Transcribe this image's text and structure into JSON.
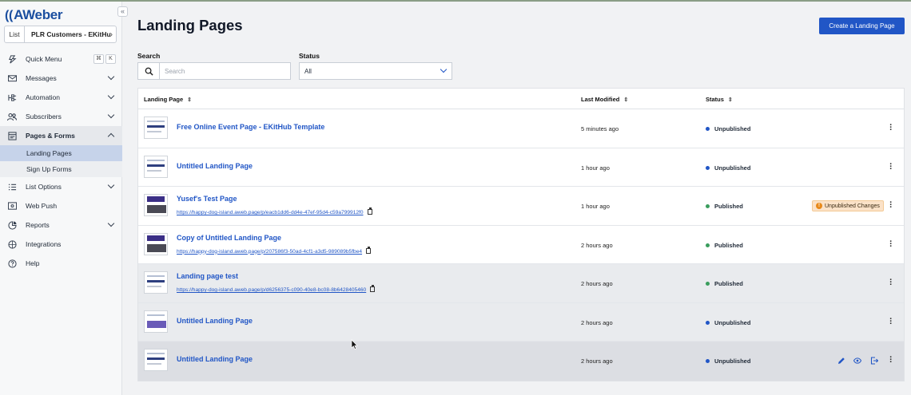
{
  "brand": {
    "logo_text": "AWeber",
    "accent": "#2156c6"
  },
  "sidebar": {
    "collapse_icon": "«",
    "list_label": "List",
    "list_value": "PLR Customers - EKitHu",
    "quick_menu": {
      "label": "Quick Menu",
      "key1": "⌘",
      "key2": "K"
    },
    "items": [
      {
        "label": "Messages",
        "icon": "envelope-icon"
      },
      {
        "label": "Automation",
        "icon": "automation-icon"
      },
      {
        "label": "Subscribers",
        "icon": "subscribers-icon"
      },
      {
        "label": "Pages & Forms",
        "icon": "pages-icon"
      },
      {
        "label": "List Options",
        "icon": "list-options-icon"
      },
      {
        "label": "Web Push",
        "icon": "web-push-icon"
      },
      {
        "label": "Reports",
        "icon": "reports-icon"
      },
      {
        "label": "Integrations",
        "icon": "integrations-icon"
      },
      {
        "label": "Help",
        "icon": "help-icon"
      }
    ],
    "subitems": [
      {
        "label": "Landing Pages",
        "active": true
      },
      {
        "label": "Sign Up Forms",
        "active": false
      }
    ]
  },
  "header": {
    "title": "Landing Pages",
    "create_button": "Create a Landing Page"
  },
  "filters": {
    "search_label": "Search",
    "search_placeholder": "Search",
    "status_label": "Status",
    "status_value": "All"
  },
  "table": {
    "columns": {
      "landing_page": "Landing Page",
      "last_modified": "Last Modified",
      "status": "Status"
    },
    "rows": [
      {
        "name": "Free Online Event Page - EKitHub Template",
        "url": "",
        "modified": "5 minutes ago",
        "status": "Unpublished",
        "badge": ""
      },
      {
        "name": "Untitled Landing Page",
        "url": "",
        "modified": "1 hour ago",
        "status": "Unpublished",
        "badge": ""
      },
      {
        "name": "Yusef's Test Page",
        "url": "https://happy-dog-island.aweb.page/p/eacb1dd6-dd4e-47ef-95d4-c59a799912f0",
        "modified": "1 hour ago",
        "status": "Published",
        "badge": "Unpublished Changes"
      },
      {
        "name": "Copy of Untitled Landing Page",
        "url": "https://happy-dog-island.aweb.page/p/207586f3-50ad-4cf1-a3d5-989089b5fbe4",
        "modified": "2 hours ago",
        "status": "Published",
        "badge": ""
      },
      {
        "name": "Landing page test",
        "url": "https://happy-dog-island.aweb.page/p/d6256375-c090-40e8-bc08-8b6428405460",
        "modified": "2 hours ago",
        "status": "Published",
        "badge": ""
      },
      {
        "name": "Untitled Landing Page",
        "url": "",
        "modified": "2 hours ago",
        "status": "Unpublished",
        "badge": ""
      },
      {
        "name": "Untitled Landing Page",
        "url": "",
        "modified": "2 hours ago",
        "status": "Unpublished",
        "badge": ""
      }
    ]
  }
}
